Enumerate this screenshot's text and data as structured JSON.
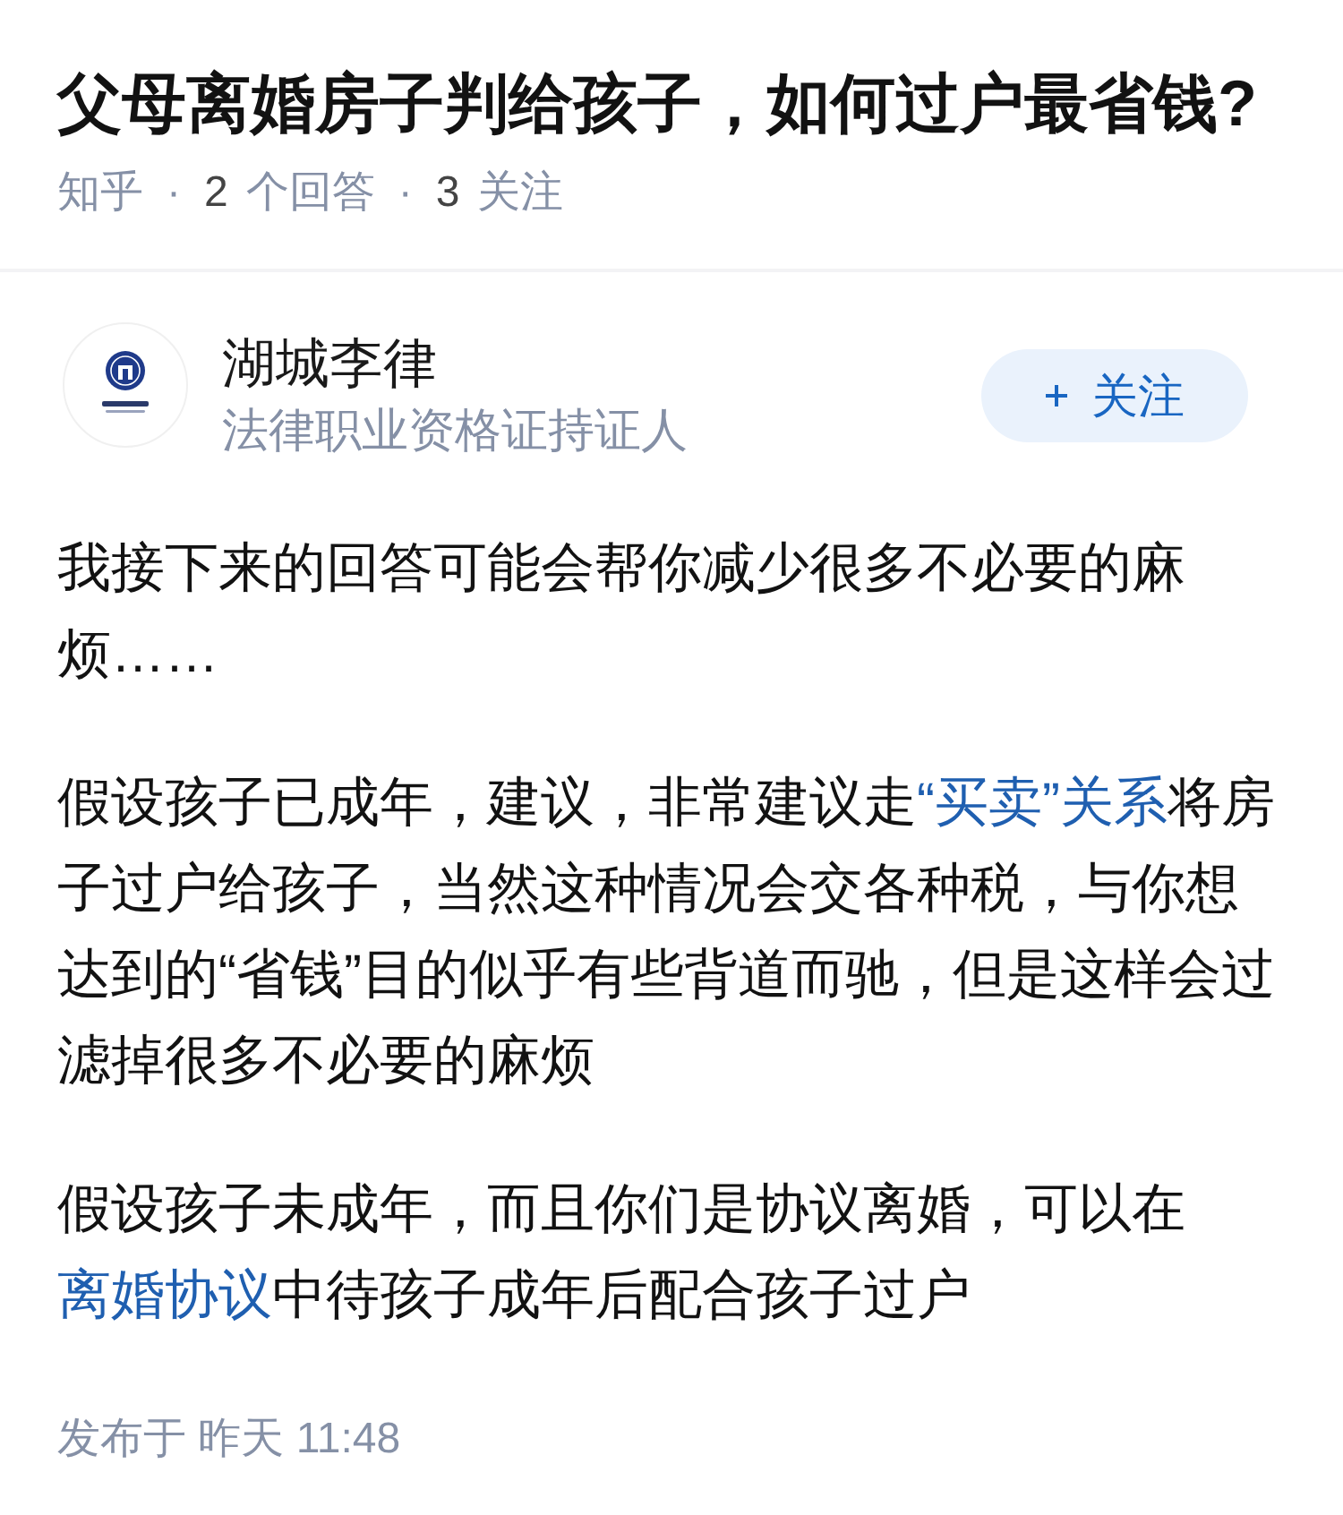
{
  "question": {
    "title": "父母离婚房子判给孩子，如何过户最省钱?",
    "meta": [
      {
        "kind": "source",
        "text": "知乎"
      },
      {
        "kind": "separator",
        "text": "·"
      },
      {
        "kind": "stat",
        "count": "2",
        "label": "个回答"
      },
      {
        "kind": "separator",
        "text": "·"
      },
      {
        "kind": "stat",
        "count": "3",
        "label": "关注"
      }
    ]
  },
  "answer": {
    "author": {
      "name": "湖城李律",
      "headline": "法律职业资格证持证人"
    },
    "follow_button": {
      "label": "关注"
    },
    "paragraphs": [
      {
        "segments": [
          {
            "kind": "text",
            "text": "我接下来的回答可能会帮你减少很多不必要的麻烦……"
          }
        ]
      },
      {
        "segments": [
          {
            "kind": "text",
            "text": "假设孩子已成年，建议，非常建议走"
          },
          {
            "kind": "link",
            "text": "“买卖”关系"
          },
          {
            "kind": "text",
            "text": "将房子过户给孩子，当然这种情况会交各种税，与你想达到的“省钱”目的似乎有些背道而驰，但是这样会过滤掉很多不必要的麻烦"
          }
        ]
      },
      {
        "segments": [
          {
            "kind": "text",
            "text": "假设孩子未成年，而且你们是协议离婚，可以在"
          },
          {
            "kind": "link",
            "text": "离婚协议"
          },
          {
            "kind": "text",
            "text": "中待孩子成年后配合孩子过户"
          }
        ]
      }
    ],
    "published": "发布于 昨天 11:48"
  }
}
